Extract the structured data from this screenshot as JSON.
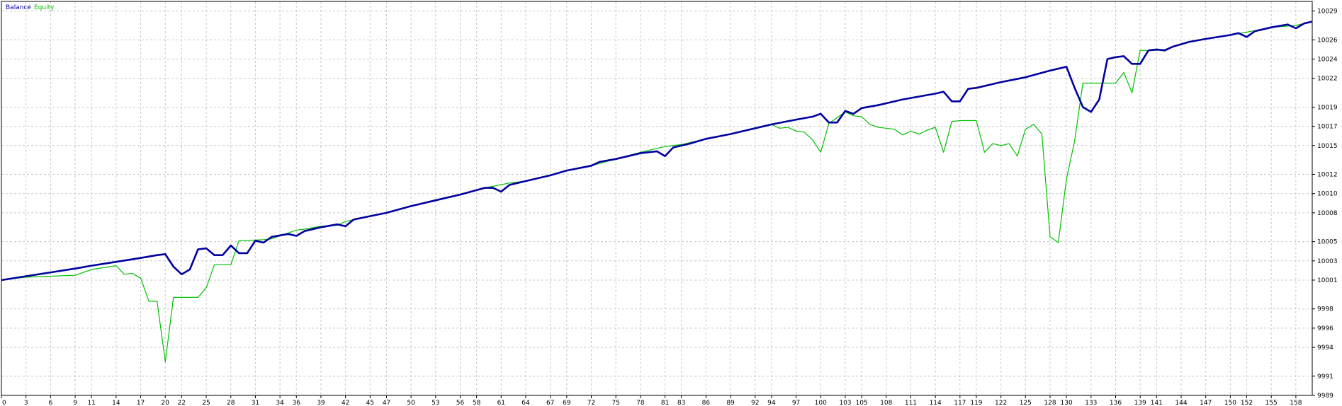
{
  "colors": {
    "balance": "#0000a0",
    "equity": "#00c000",
    "grid": "#c8c8c8",
    "frame": "#000000",
    "background": "#ffffff"
  },
  "chart_data": {
    "type": "line",
    "title": "",
    "legend": {
      "placement": "top-left",
      "separator": " / "
    },
    "grid": true,
    "xlim": [
      0,
      160
    ],
    "ylim": [
      9989,
      10030
    ],
    "x_ticks": [
      0,
      3,
      6,
      9,
      11,
      14,
      17,
      20,
      22,
      25,
      28,
      31,
      34,
      36,
      39,
      42,
      45,
      47,
      50,
      53,
      56,
      58,
      61,
      64,
      67,
      69,
      72,
      75,
      78,
      81,
      83,
      86,
      89,
      92,
      94,
      97,
      100,
      103,
      105,
      108,
      111,
      114,
      117,
      119,
      122,
      125,
      128,
      130,
      133,
      136,
      139,
      141,
      144,
      147,
      150,
      152,
      155,
      158
    ],
    "y_ticks": [
      9989,
      9991,
      9994,
      9996,
      9998,
      10001,
      10003,
      10005,
      10008,
      10010,
      10012,
      10015,
      10017,
      10019,
      10022,
      10024,
      10026,
      10029
    ],
    "series": [
      {
        "name": "Balance",
        "points": [
          [
            0,
            10001.0
          ],
          [
            3,
            10001.4
          ],
          [
            6,
            10001.8
          ],
          [
            9,
            10002.2
          ],
          [
            11,
            10002.5
          ],
          [
            14,
            10002.9
          ],
          [
            17,
            10003.3
          ],
          [
            19,
            10003.6
          ],
          [
            20,
            10003.7
          ],
          [
            21,
            10002.4
          ],
          [
            22,
            10001.6
          ],
          [
            23,
            10002.1
          ],
          [
            24,
            10004.2
          ],
          [
            25,
            10004.3
          ],
          [
            26,
            10003.6
          ],
          [
            27,
            10003.6
          ],
          [
            28,
            10004.6
          ],
          [
            29,
            10003.8
          ],
          [
            30,
            10003.8
          ],
          [
            31,
            10005.1
          ],
          [
            32,
            10004.9
          ],
          [
            33,
            10005.5
          ],
          [
            35,
            10005.8
          ],
          [
            36,
            10005.6
          ],
          [
            37,
            10006.1
          ],
          [
            39,
            10006.5
          ],
          [
            41,
            10006.8
          ],
          [
            42,
            10006.6
          ],
          [
            43,
            10007.3
          ],
          [
            47,
            10008.0
          ],
          [
            50,
            10008.7
          ],
          [
            53,
            10009.3
          ],
          [
            56,
            10009.9
          ],
          [
            59,
            10010.6
          ],
          [
            60,
            10010.6
          ],
          [
            61,
            10010.2
          ],
          [
            62,
            10010.9
          ],
          [
            64,
            10011.3
          ],
          [
            67,
            10011.9
          ],
          [
            69,
            10012.4
          ],
          [
            72,
            10012.9
          ],
          [
            73,
            10013.3
          ],
          [
            75,
            10013.6
          ],
          [
            78,
            10014.2
          ],
          [
            80,
            10014.4
          ],
          [
            81,
            10013.9
          ],
          [
            82,
            10014.8
          ],
          [
            84,
            10015.2
          ],
          [
            86,
            10015.7
          ],
          [
            89,
            10016.2
          ],
          [
            92,
            10016.8
          ],
          [
            94,
            10017.2
          ],
          [
            97,
            10017.7
          ],
          [
            99,
            10018.0
          ],
          [
            100,
            10018.3
          ],
          [
            101,
            10017.4
          ],
          [
            102,
            10017.4
          ],
          [
            103,
            10018.6
          ],
          [
            104,
            10018.3
          ],
          [
            105,
            10018.9
          ],
          [
            107,
            10019.2
          ],
          [
            108,
            10019.4
          ],
          [
            110,
            10019.8
          ],
          [
            114,
            10020.4
          ],
          [
            115,
            10020.6
          ],
          [
            116,
            10019.6
          ],
          [
            117,
            10019.6
          ],
          [
            118,
            10020.9
          ],
          [
            119,
            10021.0
          ],
          [
            122,
            10021.6
          ],
          [
            125,
            10022.1
          ],
          [
            128,
            10022.8
          ],
          [
            130,
            10023.2
          ],
          [
            131,
            10021.0
          ],
          [
            132,
            10019.0
          ],
          [
            133,
            10018.5
          ],
          [
            134,
            10019.8
          ],
          [
            135,
            10024.0
          ],
          [
            136,
            10024.2
          ],
          [
            137,
            10024.3
          ],
          [
            138,
            10023.5
          ],
          [
            139,
            10023.5
          ],
          [
            140,
            10024.9
          ],
          [
            141,
            10025.0
          ],
          [
            142,
            10024.9
          ],
          [
            143,
            10025.3
          ],
          [
            145,
            10025.8
          ],
          [
            147,
            10026.1
          ],
          [
            150,
            10026.5
          ],
          [
            151,
            10026.7
          ],
          [
            152,
            10026.3
          ],
          [
            153,
            10026.9
          ],
          [
            155,
            10027.3
          ],
          [
            157,
            10027.6
          ],
          [
            158,
            10027.2
          ],
          [
            159,
            10027.7
          ],
          [
            160,
            10027.9
          ]
        ]
      },
      {
        "name": "Equity",
        "points": [
          [
            0,
            10001.0
          ],
          [
            3,
            10001.3
          ],
          [
            6,
            10001.4
          ],
          [
            9,
            10001.5
          ],
          [
            11,
            10002.1
          ],
          [
            14,
            10002.5
          ],
          [
            15,
            10001.6
          ],
          [
            16,
            10001.7
          ],
          [
            17,
            10001.2
          ],
          [
            18,
            9998.8
          ],
          [
            19,
            9998.8
          ],
          [
            20,
            9992.5
          ],
          [
            21,
            9999.2
          ],
          [
            24,
            9999.2
          ],
          [
            25,
            10000.2
          ],
          [
            26,
            10002.6
          ],
          [
            28,
            10002.6
          ],
          [
            29,
            10005.1
          ],
          [
            32,
            10005.2
          ],
          [
            33,
            10005.3
          ],
          [
            36,
            10006.2
          ],
          [
            37,
            10006.3
          ],
          [
            39,
            10006.6
          ],
          [
            41,
            10006.7
          ],
          [
            42,
            10007.1
          ],
          [
            43,
            10007.3
          ],
          [
            47,
            10008.0
          ],
          [
            50,
            10008.7
          ],
          [
            53,
            10009.3
          ],
          [
            56,
            10009.9
          ],
          [
            59,
            10010.6
          ],
          [
            62,
            10011.1
          ],
          [
            64,
            10011.3
          ],
          [
            67,
            10011.9
          ],
          [
            69,
            10012.4
          ],
          [
            72,
            10012.9
          ],
          [
            75,
            10013.6
          ],
          [
            78,
            10014.3
          ],
          [
            81,
            10014.9
          ],
          [
            83,
            10015.1
          ],
          [
            86,
            10015.7
          ],
          [
            89,
            10016.2
          ],
          [
            92,
            10016.8
          ],
          [
            94,
            10017.2
          ],
          [
            95,
            10016.8
          ],
          [
            96,
            10016.9
          ],
          [
            97,
            10016.5
          ],
          [
            98,
            10016.4
          ],
          [
            99,
            10015.6
          ],
          [
            100,
            10014.3
          ],
          [
            101,
            10017.3
          ],
          [
            103,
            10018.5
          ],
          [
            104,
            10018.1
          ],
          [
            105,
            10018.0
          ],
          [
            106,
            10017.2
          ],
          [
            107,
            10016.9
          ],
          [
            108,
            10016.8
          ],
          [
            109,
            10016.7
          ],
          [
            110,
            10016.1
          ],
          [
            111,
            10016.5
          ],
          [
            112,
            10016.2
          ],
          [
            113,
            10016.6
          ],
          [
            114,
            10016.9
          ],
          [
            115,
            10014.3
          ],
          [
            116,
            10017.5
          ],
          [
            117,
            10017.6
          ],
          [
            118,
            10017.6
          ],
          [
            119,
            10017.6
          ],
          [
            120,
            10014.3
          ],
          [
            121,
            10015.2
          ],
          [
            122,
            10015.0
          ],
          [
            123,
            10015.2
          ],
          [
            124,
            10013.9
          ],
          [
            125,
            10016.7
          ],
          [
            126,
            10017.2
          ],
          [
            127,
            10016.2
          ],
          [
            128,
            10005.5
          ],
          [
            129,
            10004.9
          ],
          [
            130,
            10011.5
          ],
          [
            131,
            10015.5
          ],
          [
            132,
            10021.5
          ],
          [
            133,
            10021.5
          ],
          [
            134,
            10021.5
          ],
          [
            135,
            10021.5
          ],
          [
            136,
            10021.5
          ],
          [
            137,
            10022.6
          ],
          [
            138,
            10020.5
          ],
          [
            139,
            10024.9
          ],
          [
            141,
            10024.9
          ],
          [
            142,
            10025.0
          ],
          [
            143,
            10025.3
          ],
          [
            145,
            10025.8
          ],
          [
            147,
            10026.1
          ],
          [
            150,
            10026.5
          ],
          [
            152,
            10026.8
          ],
          [
            155,
            10027.3
          ],
          [
            158,
            10027.5
          ],
          [
            160,
            10027.9
          ]
        ]
      }
    ]
  }
}
